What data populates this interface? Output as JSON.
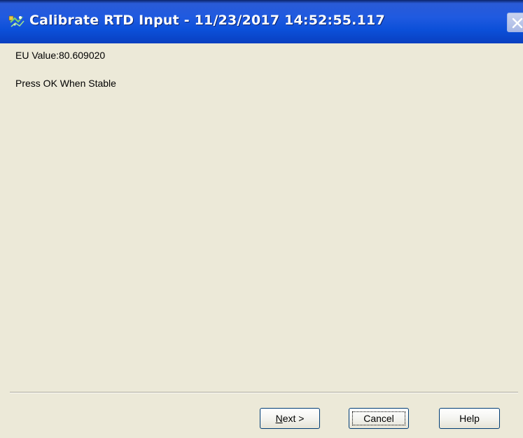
{
  "window": {
    "title": "Calibrate RTD Input - 11/23/2017 14:52:55.117",
    "title_icon": "app-icon",
    "close_icon": "close-icon"
  },
  "content": {
    "eu_value_text": "EU Value:80.609020",
    "instruction_text": "Press OK When Stable"
  },
  "buttons": {
    "next_mnemonic": "N",
    "next_rest": "ext >",
    "cancel_label": "Cancel",
    "help_label": "Help"
  },
  "colors": {
    "titlebar": "#0b4fd8",
    "dialog_background": "#ece9d8",
    "button_border": "#003c74"
  }
}
